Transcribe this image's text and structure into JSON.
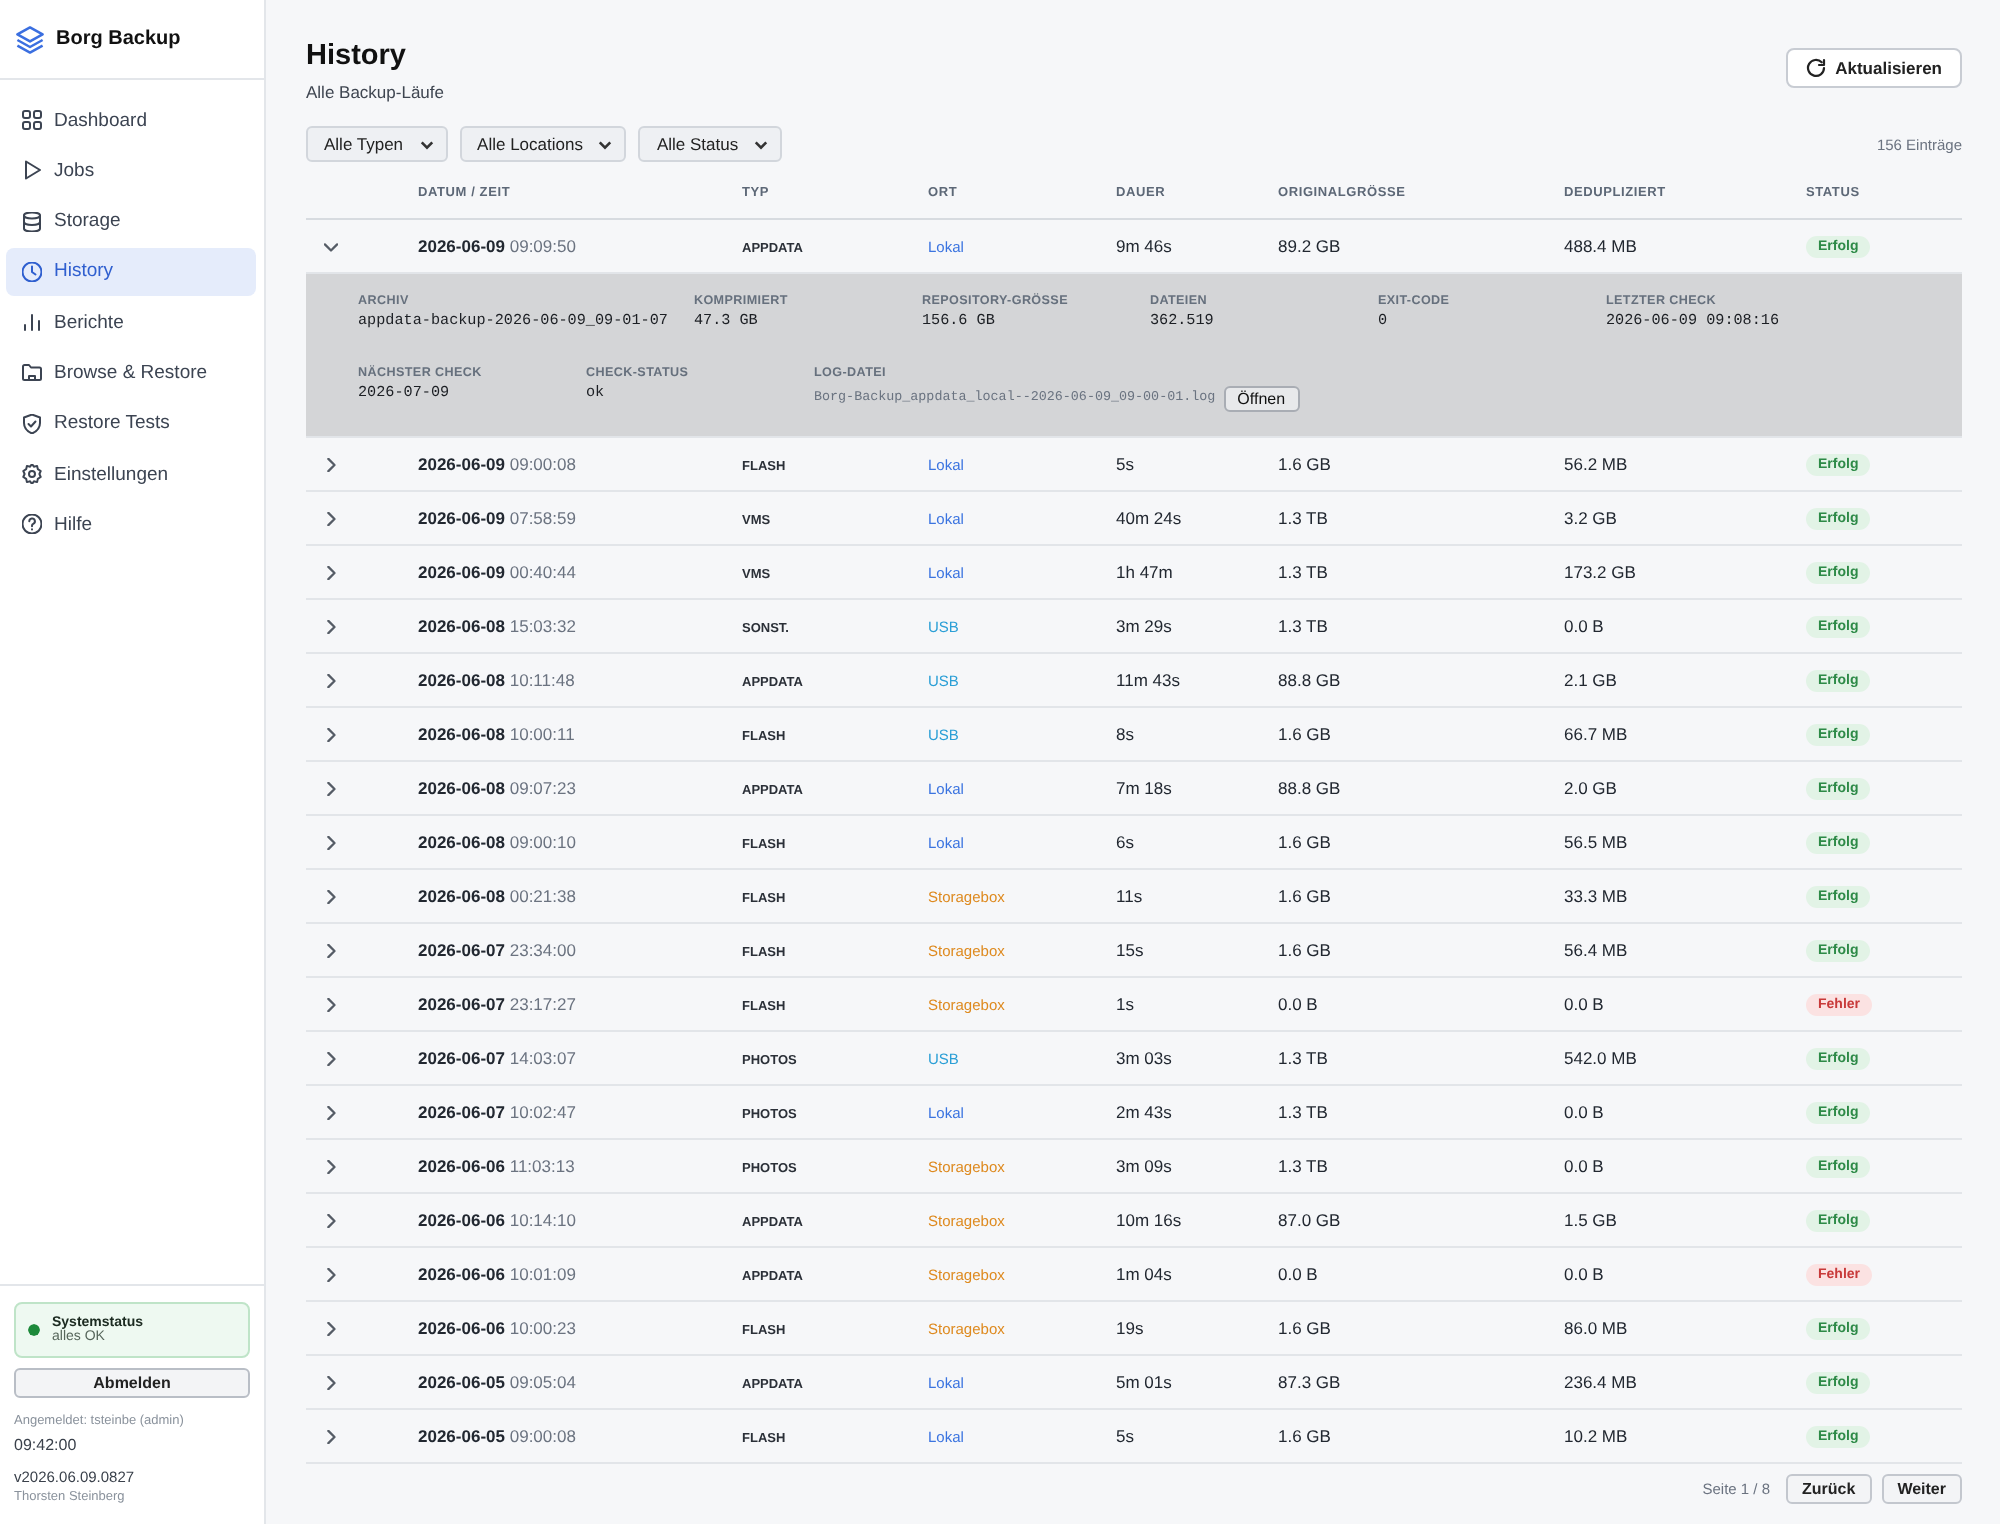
{
  "sidebar": {
    "brand": "Borg Backup",
    "items": [
      {
        "label": "Dashboard",
        "selected": false
      },
      {
        "label": "Jobs",
        "selected": false
      },
      {
        "label": "Storage",
        "selected": false
      },
      {
        "label": "History",
        "selected": true
      },
      {
        "label": "Berichte",
        "selected": false
      },
      {
        "label": "Browse & Restore",
        "selected": false
      },
      {
        "label": "Restore Tests",
        "selected": false
      },
      {
        "label": "Einstellungen",
        "selected": false
      },
      {
        "label": "Hilfe",
        "selected": false
      }
    ],
    "system_status": {
      "title": "Systemstatus",
      "text": "alles OK",
      "ok": true
    },
    "logout_button": "Abmelden",
    "logged_in": "Angemeldet: tsteinbe (admin)",
    "clock": "09:42:00",
    "version": "v2026.06.09.0827",
    "author": "Thorsten Steinberg"
  },
  "header": {
    "title": "History",
    "subtitle": "Alle Backup-Läufe",
    "refresh_button": "Aktualisieren"
  },
  "filters": [
    {
      "value": "Alle Typen"
    },
    {
      "value": "Alle Locations"
    },
    {
      "value": "Alle Status"
    }
  ],
  "count": "156 Einträge",
  "table": {
    "columns": [
      "DATUM / ZEIT",
      "TYP",
      "ORT",
      "DAUER",
      "ORIGINALGRÖSSE",
      "DEDUPLIZIERT",
      "STATUS"
    ],
    "rows": [
      {
        "expanded": true,
        "date": "2026-06-09",
        "time": "09:09:50",
        "type": "APPDATA",
        "location": {
          "text": "Lokal",
          "color": "#3b74e0"
        },
        "duration": "9m 46s",
        "original": "89.2 GB",
        "dedup": "488.4 MB",
        "status": {
          "text": "Erfolg",
          "kind": "success"
        },
        "details": [
          {
            "kind": "text",
            "label": "ARCHIV",
            "value": "appdata-backup-2026-06-09_09-01-07"
          },
          {
            "kind": "text",
            "label": "KOMPRIMIERT",
            "value": "47.3 GB"
          },
          {
            "kind": "text",
            "label": "REPOSITORY-GRÖSSE",
            "value": "156.6 GB"
          },
          {
            "kind": "text",
            "label": "DATEIEN",
            "value": "362.519"
          },
          {
            "kind": "text",
            "label": "EXIT-CODE",
            "value": "0"
          },
          {
            "kind": "text",
            "label": "LETZTER CHECK",
            "value": "2026-06-09 09:08:16"
          },
          {
            "kind": "text",
            "label": "NÄCHSTER CHECK",
            "value": "2026-07-09"
          },
          {
            "kind": "text",
            "label": "CHECK-STATUS",
            "value": "ok"
          },
          {
            "kind": "file",
            "label": "LOG-DATEI",
            "value": "Borg-Backup_appdata_local--2026-06-09_09-00-01.log",
            "button": "Öffnen"
          }
        ]
      },
      {
        "expanded": false,
        "date": "2026-06-09",
        "time": "09:00:08",
        "type": "FLASH",
        "location": {
          "text": "Lokal",
          "color": "#3b74e0"
        },
        "duration": "5s",
        "original": "1.6 GB",
        "dedup": "56.2 MB",
        "status": {
          "text": "Erfolg",
          "kind": "success"
        }
      },
      {
        "expanded": false,
        "date": "2026-06-09",
        "time": "07:58:59",
        "type": "VMS",
        "location": {
          "text": "Lokal",
          "color": "#3b74e0"
        },
        "duration": "40m 24s",
        "original": "1.3 TB",
        "dedup": "3.2 GB",
        "status": {
          "text": "Erfolg",
          "kind": "success"
        }
      },
      {
        "expanded": false,
        "date": "2026-06-09",
        "time": "00:40:44",
        "type": "VMS",
        "location": {
          "text": "Lokal",
          "color": "#3b74e0"
        },
        "duration": "1h 47m",
        "original": "1.3 TB",
        "dedup": "173.2 GB",
        "status": {
          "text": "Erfolg",
          "kind": "success"
        }
      },
      {
        "expanded": false,
        "date": "2026-06-08",
        "time": "15:03:32",
        "type": "SONST.",
        "location": {
          "text": "USB",
          "color": "#2b9fd6"
        },
        "duration": "3m 29s",
        "original": "1.3 TB",
        "dedup": "0.0 B",
        "status": {
          "text": "Erfolg",
          "kind": "success"
        }
      },
      {
        "expanded": false,
        "date": "2026-06-08",
        "time": "10:11:48",
        "type": "APPDATA",
        "location": {
          "text": "USB",
          "color": "#2b9fd6"
        },
        "duration": "11m 43s",
        "original": "88.8 GB",
        "dedup": "2.1 GB",
        "status": {
          "text": "Erfolg",
          "kind": "success"
        }
      },
      {
        "expanded": false,
        "date": "2026-06-08",
        "time": "10:00:11",
        "type": "FLASH",
        "location": {
          "text": "USB",
          "color": "#2b9fd6"
        },
        "duration": "8s",
        "original": "1.6 GB",
        "dedup": "66.7 MB",
        "status": {
          "text": "Erfolg",
          "kind": "success"
        }
      },
      {
        "expanded": false,
        "date": "2026-06-08",
        "time": "09:07:23",
        "type": "APPDATA",
        "location": {
          "text": "Lokal",
          "color": "#3b74e0"
        },
        "duration": "7m 18s",
        "original": "88.8 GB",
        "dedup": "2.0 GB",
        "status": {
          "text": "Erfolg",
          "kind": "success"
        }
      },
      {
        "expanded": false,
        "date": "2026-06-08",
        "time": "09:00:10",
        "type": "FLASH",
        "location": {
          "text": "Lokal",
          "color": "#3b74e0"
        },
        "duration": "6s",
        "original": "1.6 GB",
        "dedup": "56.5 MB",
        "status": {
          "text": "Erfolg",
          "kind": "success"
        }
      },
      {
        "expanded": false,
        "date": "2026-06-08",
        "time": "00:21:38",
        "type": "FLASH",
        "location": {
          "text": "Storagebox",
          "color": "#de8a1f"
        },
        "duration": "11s",
        "original": "1.6 GB",
        "dedup": "33.3 MB",
        "status": {
          "text": "Erfolg",
          "kind": "success"
        }
      },
      {
        "expanded": false,
        "date": "2026-06-07",
        "time": "23:34:00",
        "type": "FLASH",
        "location": {
          "text": "Storagebox",
          "color": "#de8a1f"
        },
        "duration": "15s",
        "original": "1.6 GB",
        "dedup": "56.4 MB",
        "status": {
          "text": "Erfolg",
          "kind": "success"
        }
      },
      {
        "expanded": false,
        "date": "2026-06-07",
        "time": "23:17:27",
        "type": "FLASH",
        "location": {
          "text": "Storagebox",
          "color": "#de8a1f"
        },
        "duration": "1s",
        "original": "0.0 B",
        "dedup": "0.0 B",
        "status": {
          "text": "Fehler",
          "kind": "error"
        }
      },
      {
        "expanded": false,
        "date": "2026-06-07",
        "time": "14:03:07",
        "type": "PHOTOS",
        "location": {
          "text": "USB",
          "color": "#2b9fd6"
        },
        "duration": "3m 03s",
        "original": "1.3 TB",
        "dedup": "542.0 MB",
        "status": {
          "text": "Erfolg",
          "kind": "success"
        }
      },
      {
        "expanded": false,
        "date": "2026-06-07",
        "time": "10:02:47",
        "type": "PHOTOS",
        "location": {
          "text": "Lokal",
          "color": "#3b74e0"
        },
        "duration": "2m 43s",
        "original": "1.3 TB",
        "dedup": "0.0 B",
        "status": {
          "text": "Erfolg",
          "kind": "success"
        }
      },
      {
        "expanded": false,
        "date": "2026-06-06",
        "time": "11:03:13",
        "type": "PHOTOS",
        "location": {
          "text": "Storagebox",
          "color": "#de8a1f"
        },
        "duration": "3m 09s",
        "original": "1.3 TB",
        "dedup": "0.0 B",
        "status": {
          "text": "Erfolg",
          "kind": "success"
        }
      },
      {
        "expanded": false,
        "date": "2026-06-06",
        "time": "10:14:10",
        "type": "APPDATA",
        "location": {
          "text": "Storagebox",
          "color": "#de8a1f"
        },
        "duration": "10m 16s",
        "original": "87.0 GB",
        "dedup": "1.5 GB",
        "status": {
          "text": "Erfolg",
          "kind": "success"
        }
      },
      {
        "expanded": false,
        "date": "2026-06-06",
        "time": "10:01:09",
        "type": "APPDATA",
        "location": {
          "text": "Storagebox",
          "color": "#de8a1f"
        },
        "duration": "1m 04s",
        "original": "0.0 B",
        "dedup": "0.0 B",
        "status": {
          "text": "Fehler",
          "kind": "error"
        }
      },
      {
        "expanded": false,
        "date": "2026-06-06",
        "time": "10:00:23",
        "type": "FLASH",
        "location": {
          "text": "Storagebox",
          "color": "#de8a1f"
        },
        "duration": "19s",
        "original": "1.6 GB",
        "dedup": "86.0 MB",
        "status": {
          "text": "Erfolg",
          "kind": "success"
        }
      },
      {
        "expanded": false,
        "date": "2026-06-05",
        "time": "09:05:04",
        "type": "APPDATA",
        "location": {
          "text": "Lokal",
          "color": "#3b74e0"
        },
        "duration": "5m 01s",
        "original": "87.3 GB",
        "dedup": "236.4 MB",
        "status": {
          "text": "Erfolg",
          "kind": "success"
        }
      },
      {
        "expanded": false,
        "date": "2026-06-05",
        "time": "09:00:08",
        "type": "FLASH",
        "location": {
          "text": "Lokal",
          "color": "#3b74e0"
        },
        "duration": "5s",
        "original": "1.6 GB",
        "dedup": "10.2 MB",
        "status": {
          "text": "Erfolg",
          "kind": "success"
        }
      }
    ]
  },
  "pagination": {
    "page": "Seite 1 / 8",
    "buttons": [
      "Zurück",
      "Weiter"
    ]
  }
}
